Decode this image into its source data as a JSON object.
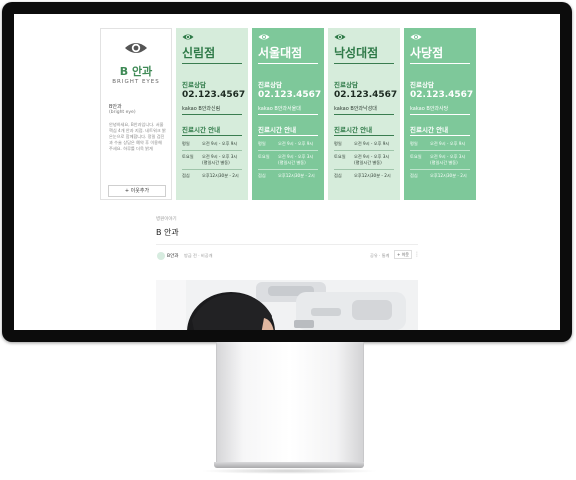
{
  "profile": {
    "brand": "B 안과",
    "brand_en": "BRIGHT EYES",
    "name": "B안과",
    "sub": "(bright eye)",
    "description": "안녕하세요, B안과입니다. 서울 핵심 4개 안과 지점. 네트워크 밝은눈으로 함께합니다. 정밀 검진과 수술 상담은 예약 후 이용해 주세요. 하루를 더욱 밝게",
    "follow_label": "+ 이웃추가"
  },
  "branches": [
    {
      "name": "신림점",
      "consult_label": "진료상담",
      "phone": "02.123.4567",
      "kakao": "kakao B안과신림",
      "hours_label": "진료시간 안내",
      "hours": [
        {
          "day": "평일",
          "time": "오전 9시 - 오후 9시"
        },
        {
          "day": "토요일",
          "time": "오전 9시 - 오후 3시 (평일시간 별동)"
        },
        {
          "day": "점심",
          "time": "오후12시30분 - 2시"
        }
      ]
    },
    {
      "name": "서울대점",
      "consult_label": "진료상담",
      "phone": "02.123.4567",
      "kakao": "kakao B안과서울대",
      "hours_label": "진료시간 안내",
      "hours": [
        {
          "day": "평일",
          "time": "오전 9시 - 오후 9시"
        },
        {
          "day": "토요일",
          "time": "오전 9시 - 오후 3시 (평일시간 별동)"
        },
        {
          "day": "점심",
          "time": "오후12시30분 - 2시"
        }
      ]
    },
    {
      "name": "낙성대점",
      "consult_label": "진료상담",
      "phone": "02.123.4567",
      "kakao": "kakao B안과낙성대",
      "hours_label": "진료시간 안내",
      "hours": [
        {
          "day": "평일",
          "time": "오전 9시 - 오후 9시"
        },
        {
          "day": "토요일",
          "time": "오전 9시 - 오후 3시 (평일시간 별동)"
        },
        {
          "day": "점심",
          "time": "오후12시30분 - 2시"
        }
      ]
    },
    {
      "name": "사당점",
      "consult_label": "진료상담",
      "phone": "02.123.4567",
      "kakao": "kakao B안과사당",
      "hours_label": "진료시간 안내",
      "hours": [
        {
          "day": "평일",
          "time": "오전 9시 - 오후 9시"
        },
        {
          "day": "토요일",
          "time": "오전 9시 - 오후 3시 (평일시간 별동)"
        },
        {
          "day": "점심",
          "time": "오후12시30분 - 2시"
        }
      ]
    }
  ],
  "post": {
    "breadcrumb": "병원이야기",
    "title": "B 안과",
    "author": "B안과",
    "time": "방금 전 · 비공개",
    "stats": "공유 · 통계",
    "follow_label": "+ 이웃",
    "more": "⋮"
  },
  "colors": {
    "light_card": "#d6ecdb",
    "dark_card": "#7ec89a",
    "brand_green": "#2f7a48"
  }
}
